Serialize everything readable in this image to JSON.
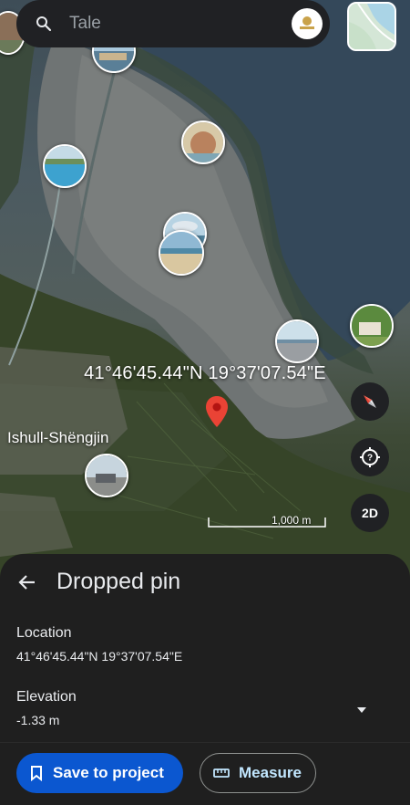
{
  "search": {
    "placeholder": "Tale"
  },
  "map": {
    "coordinates": "41°46'45.44\"N 19°37'07.54\"E",
    "place_label": "Ishull-Shëngjin",
    "scale_label": "1,000 m",
    "view_mode": "2D"
  },
  "sheet": {
    "title": "Dropped pin",
    "location_label": "Location",
    "location_value": "41°46'45.44\"N 19°37'07.54\"E",
    "elevation_label": "Elevation",
    "elevation_value": "-1.33 m",
    "save_button": "Save to project",
    "measure_button": "Measure"
  },
  "colors": {
    "primary": "#0b57d0",
    "pin": "#ea4335",
    "sheet": "#1f1f1f"
  }
}
